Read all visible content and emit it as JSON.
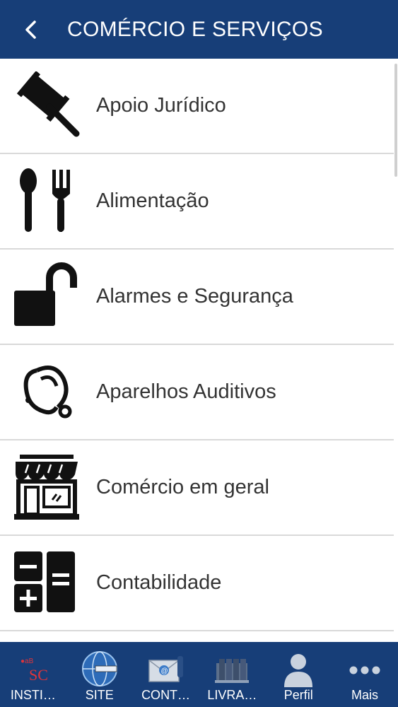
{
  "header": {
    "title": "COMÉRCIO E SERVIÇOS",
    "back_icon": "chevron-left-icon"
  },
  "list": {
    "items": [
      {
        "label": "Apoio Jurídico",
        "icon": "gavel-icon"
      },
      {
        "label": "Alimentação",
        "icon": "spoon-fork-icon"
      },
      {
        "label": "Alarmes e Segurança",
        "icon": "padlock-icon"
      },
      {
        "label": "Aparelhos Auditivos",
        "icon": "hearing-aid-icon"
      },
      {
        "label": "Comércio em geral",
        "icon": "storefront-icon"
      },
      {
        "label": "Contabilidade",
        "icon": "calculator-icon"
      }
    ]
  },
  "tabbar": {
    "tabs": [
      {
        "label": "INSTI…",
        "icon": "institution-logo-icon"
      },
      {
        "label": "SITE",
        "icon": "globe-icon"
      },
      {
        "label": "CONT…",
        "icon": "contact-envelope-icon"
      },
      {
        "label": "LIVRA…",
        "icon": "books-icon"
      },
      {
        "label": "Perfil",
        "icon": "person-icon"
      },
      {
        "label": "Mais",
        "icon": "more-dots-icon"
      }
    ]
  },
  "colors": {
    "brand": "#173e78",
    "divider": "#d9d9d9",
    "text": "#333333"
  }
}
